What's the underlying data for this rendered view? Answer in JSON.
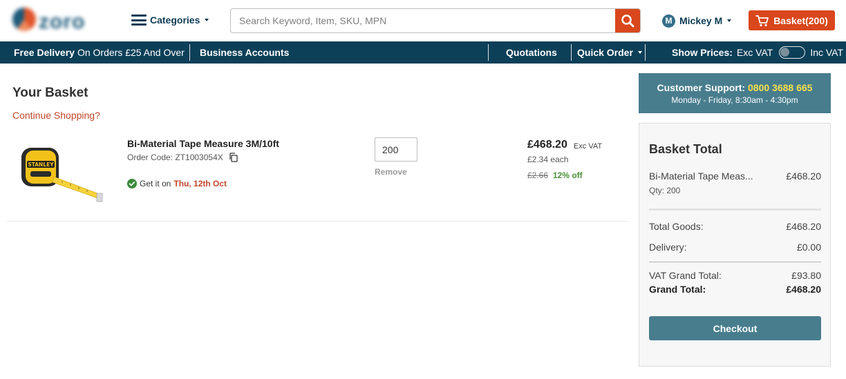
{
  "header": {
    "logo_text": "zoro",
    "categories_label": "Categories",
    "search": {
      "placeholder": "Search Keyword, Item, SKU, MPN",
      "value": ""
    },
    "user": {
      "initial": "M",
      "name": "Mickey M"
    },
    "basket_label": "Basket(200)"
  },
  "navbar": {
    "free_delivery_bold": "Free Delivery",
    "free_delivery_rest": "On Orders £25 And Over",
    "business_accounts": "Business Accounts",
    "quotations": "Quotations",
    "quick_order": "Quick Order",
    "show_prices": "Show Prices:",
    "exc_vat": "Exc VAT",
    "inc_vat": "Inc VAT"
  },
  "basket": {
    "title": "Your Basket",
    "continue_shopping": "Continue Shopping?",
    "item": {
      "name": "Bi-Material Tape Measure 3M/10ft",
      "order_code": "Order Code: ZT1003054X",
      "delivery_prefix": "Get it on",
      "delivery_date": "Thu, 12th Oct",
      "quantity": "200",
      "remove_label": "Remove",
      "price": "£468.20",
      "price_vat_label": "Exc VAT",
      "each": "£2.34 each",
      "was_price": "£2.66",
      "discount": "12% off",
      "image_brand_text": "STANLEY"
    }
  },
  "support": {
    "label": "Customer Support:",
    "phone": "0800 3688 665",
    "hours": "Monday - Friday, 8:30am - 4:30pm"
  },
  "totals": {
    "title": "Basket Total",
    "item_name": "Bi-Material Tape Meas...",
    "item_price": "£468.20",
    "item_qty": "Qty: 200",
    "total_goods_label": "Total Goods:",
    "total_goods_value": "£468.20",
    "delivery_label": "Delivery:",
    "delivery_value": "£0.00",
    "vat_label": "VAT Grand Total:",
    "vat_value": "£93.80",
    "grand_label": "Grand Total:",
    "grand_value": "£468.20",
    "checkout_label": "Checkout"
  },
  "colors": {
    "brand_orange": "#d9471c",
    "nav_blue": "#0c3f58",
    "teal": "#487d8e",
    "success_green": "#3c8a3c",
    "phone_yellow": "#f6e04a"
  },
  "icons": [
    "hamburger-icon",
    "caret-down-icon",
    "search-icon",
    "cart-icon",
    "copy-icon",
    "check-circle-icon"
  ]
}
